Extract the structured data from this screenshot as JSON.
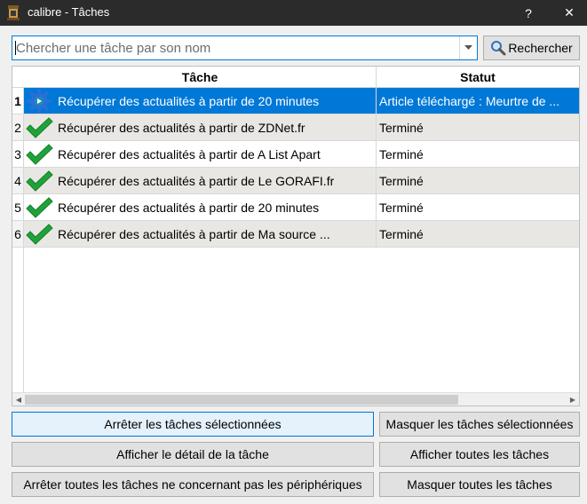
{
  "window": {
    "title": "calibre - Tâches",
    "help_label": "?",
    "close_label": "✕"
  },
  "search": {
    "placeholder": "Chercher une tâche par son nom",
    "value": "",
    "button_label": "Rechercher"
  },
  "table": {
    "columns": [
      "Tâche",
      "Statut"
    ],
    "rows": [
      {
        "num": "1",
        "icon": "gear-icon",
        "task": "Récupérer des actualités à partir de 20 minutes",
        "status": "Article téléchargé : Meurtre de ...",
        "selected": true
      },
      {
        "num": "2",
        "icon": "checkmark-icon",
        "task": "Récupérer des actualités à partir de ZDNet.fr",
        "status": "Terminé",
        "selected": false
      },
      {
        "num": "3",
        "icon": "checkmark-icon",
        "task": "Récupérer des actualités à partir de A List Apart",
        "status": "Terminé",
        "selected": false
      },
      {
        "num": "4",
        "icon": "checkmark-icon",
        "task": "Récupérer des actualités à partir de Le GORAFI.fr",
        "status": "Terminé",
        "selected": false
      },
      {
        "num": "5",
        "icon": "checkmark-icon",
        "task": "Récupérer des actualités à partir de 20 minutes",
        "status": "Terminé",
        "selected": false
      },
      {
        "num": "6",
        "icon": "checkmark-icon",
        "task": "Récupérer des actualités à partir de Ma source ...",
        "status": "Terminé",
        "selected": false
      }
    ]
  },
  "buttons": {
    "stop_selected": "Arrêter les tâches sélectionnées",
    "hide_selected": "Masquer les tâches sélectionnées",
    "show_details": "Afficher le détail de la tâche",
    "show_all": "Afficher toutes les tâches",
    "stop_non_device": "Arrêter toutes les tâches ne concernant pas les périphériques",
    "hide_all": "Masquer toutes les tâches"
  },
  "colors": {
    "selection": "#0078d7",
    "check_green": "#1fa339",
    "gear_blue": "#2a6fd6",
    "titlebar": "#2b2b2b"
  }
}
